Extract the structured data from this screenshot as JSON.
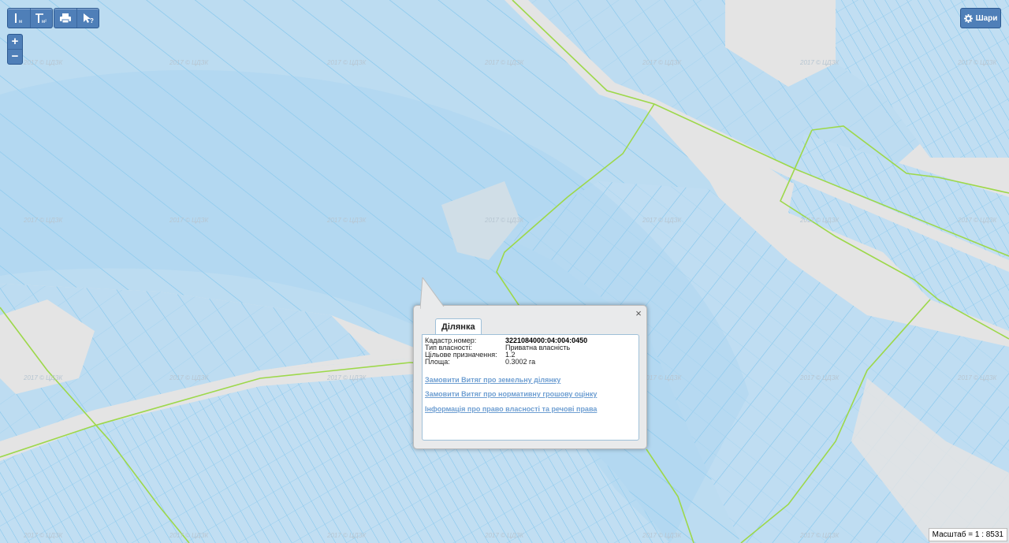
{
  "toolbar": {
    "measure_icon": "distance-measure-icon",
    "area_icon": "area-measure-icon",
    "print_icon": "printer-icon",
    "identify_icon": "identify-cursor-icon"
  },
  "zoom": {
    "plus": "+",
    "minus": "−"
  },
  "layers": {
    "label": "Шари",
    "icon": "gear-icon"
  },
  "scale": {
    "text": "Масштаб = 1 : 8531"
  },
  "popup": {
    "tab": "Ділянка",
    "rows": [
      {
        "label": "Кадастр.номер:",
        "value": "3221084000:04:004:0450"
      },
      {
        "label": "Тип власності:",
        "value": "Приватна власність"
      },
      {
        "label": "Цільове призначення:",
        "value": "1.2"
      },
      {
        "label": "Площа:",
        "value": "0.3002 га"
      }
    ],
    "links": [
      "Замовити Витяг про земельну ділянку",
      "Замовити Витяг про нормативну грошову оцінку",
      "Інформація про право власності та речові права"
    ]
  },
  "colors": {
    "parcel_fill": "#b9d9ef",
    "parcel_border": "#7cc3ec",
    "boundary": "#9dd84a",
    "background": "#e4e4e4",
    "button": "#4f7fb8"
  }
}
